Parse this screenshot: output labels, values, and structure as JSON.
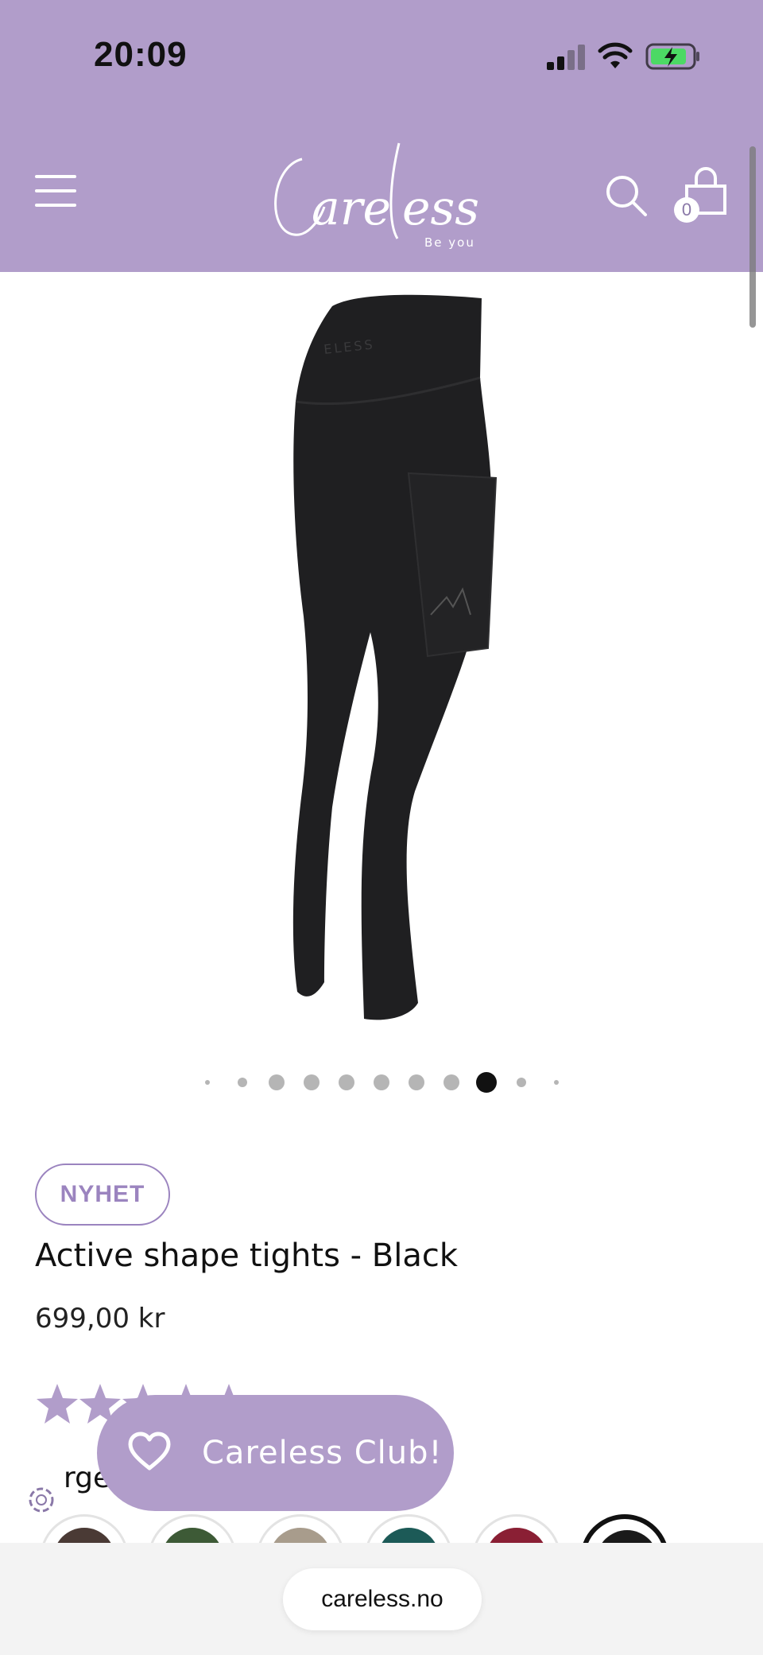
{
  "status_bar": {
    "time": "20:09"
  },
  "header": {
    "logo_text": "Careless",
    "logo_tagline": "Be you",
    "cart_count": "0"
  },
  "product": {
    "badge": "NYHET",
    "title": "Active shape tights - Black",
    "price": "699,00 kr",
    "rating_stars": 5,
    "colors_label_partial": "rge",
    "carousel": {
      "dot_count": 11,
      "active_index": 8
    },
    "swatches": [
      {
        "name": "brown",
        "color": "#4a3a35"
      },
      {
        "name": "green",
        "color": "#3d5a36"
      },
      {
        "name": "beige",
        "color": "#a89c8c"
      },
      {
        "name": "teal",
        "color": "#1c5a57"
      },
      {
        "name": "burgundy",
        "color": "#8a1f34"
      },
      {
        "name": "black",
        "color": "#1a1a1a",
        "selected": true
      }
    ]
  },
  "club_button": {
    "label": "Careless Club!"
  },
  "browser": {
    "url": "careless.no"
  },
  "colors": {
    "brand_purple": "#b19dca",
    "badge_purple": "#9b84bf"
  }
}
